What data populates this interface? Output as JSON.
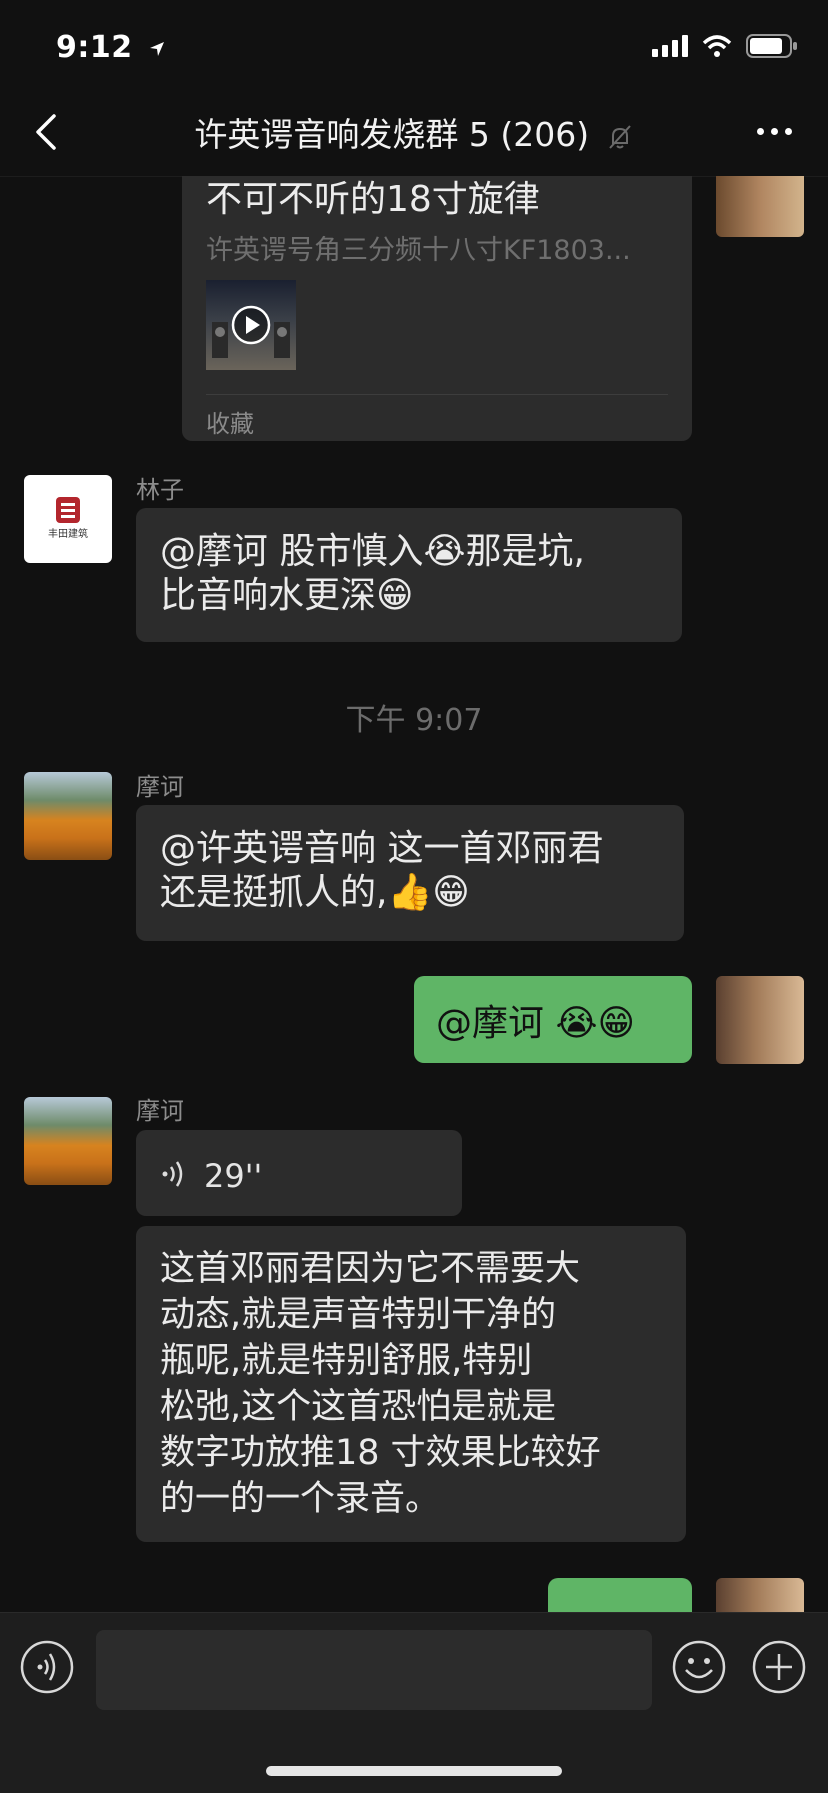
{
  "status": {
    "time": "9:12"
  },
  "header": {
    "title": "许英谔音响发烧群 5 (206)"
  },
  "card": {
    "title": "不可不听的18寸旋律",
    "subtitle": "许英谔号角三分频十八寸KF1803...",
    "source": "收藏"
  },
  "messages": [
    {
      "sender": "林子",
      "text_line1": "@摩诃 股市慎入😭那是坑,",
      "text_line2": "比音响水更深😁"
    },
    {
      "time": "下午 9:07"
    },
    {
      "sender": "摩诃",
      "text_line1": "@许英谔音响 这一首邓丽君",
      "text_line2": "还是挺抓人的,👍😁"
    },
    {
      "self_text": "@摩诃 😭😁"
    },
    {
      "sender": "摩诃",
      "voice_duration": "29''",
      "transcript": [
        "这首邓丽君因为它不需要大",
        "动态,就是声音特别干净的",
        "瓶呢,就是特别舒服,特别",
        "松弛,这个这首恐怕是就是",
        "数字功放推18 寸效果比较好",
        "的一的一个录音。"
      ]
    }
  ],
  "logos": {
    "linzi_avatar_text": "丰田建筑"
  },
  "colors": {
    "background": "#111111",
    "bubble": "#2c2c2c",
    "self_bubble": "#5fb566"
  }
}
